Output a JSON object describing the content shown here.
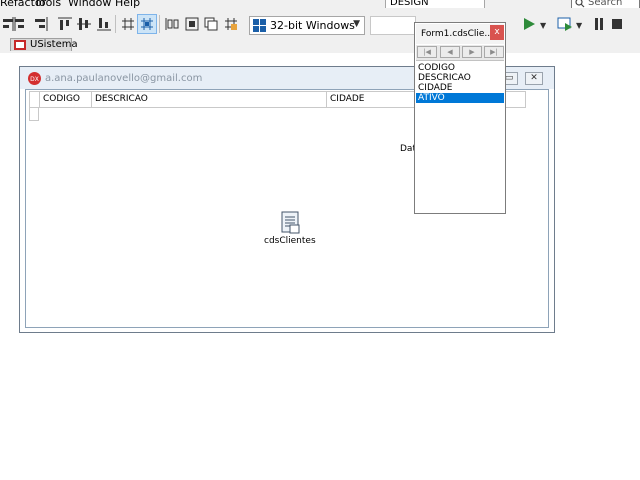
{
  "menu": {
    "items": [
      "Refactor",
      "Tools",
      "Window",
      "Help"
    ]
  },
  "toolbar": {
    "platform": "32-bit Windows",
    "build_configuration": "DESIGN",
    "search_placeholder": "Search"
  },
  "tabs": {
    "active_file": "USistema"
  },
  "form": {
    "title": "a.ana.paulanovello@gmail.com",
    "grid_columns": [
      "CODIGO",
      "DESCRICAO",
      "CIDADE"
    ],
    "datasource_text": "Dat",
    "component_label": "cdsClientes"
  },
  "fields_editor": {
    "title": "Form1.cdsClie...",
    "close_glyph": "x",
    "fields": [
      "CODIGO",
      "DESCRICAO",
      "CIDADE",
      "ATIVO"
    ],
    "selected_field": "ATIVO",
    "nav_glyphs": [
      "|◀",
      "◀",
      "▶",
      "▶|"
    ]
  },
  "colors": {
    "accent": "#0078d7",
    "close_red": "#d9534f",
    "run_green": "#2e8b3a"
  }
}
